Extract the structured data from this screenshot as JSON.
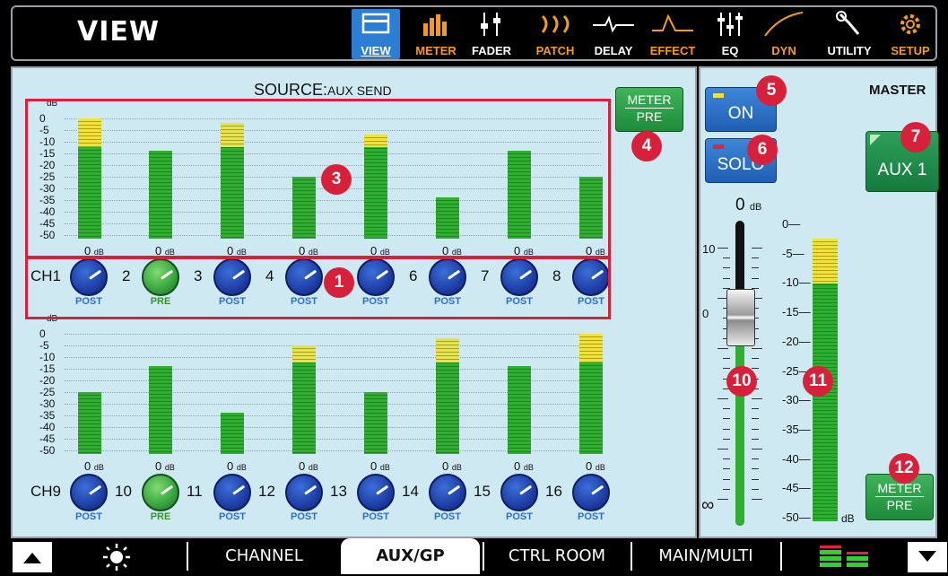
{
  "header": {
    "title": "VIEW",
    "menu": [
      {
        "label": "VIEW",
        "icon": "view-icon",
        "active": true
      },
      {
        "label": "METER",
        "icon": "meter-icon"
      },
      {
        "label": "FADER",
        "icon": "fader-icon"
      },
      {
        "label": "PATCH",
        "icon": "patch-icon"
      },
      {
        "label": "DELAY",
        "icon": "delay-icon"
      },
      {
        "label": "EFFECT",
        "icon": "effect-icon"
      },
      {
        "label": "EQ",
        "icon": "eq-icon"
      },
      {
        "label": "DYN",
        "icon": "dyn-icon"
      },
      {
        "label": "UTILITY",
        "icon": "utility-icon"
      },
      {
        "label": "SETUP",
        "icon": "setup-icon"
      }
    ]
  },
  "source": {
    "label": "SOURCE:",
    "value": "AUX SEND"
  },
  "scale": {
    "unit": "dB",
    "ticks": [
      "0",
      "-5",
      "-10",
      "-15",
      "-20",
      "-25",
      "-30",
      "-35",
      "-40",
      "-45",
      "-50"
    ]
  },
  "db_value": "0",
  "db_unit": "dB",
  "bank1": {
    "levels_db": [
      0,
      -14,
      -2,
      -25,
      -7,
      -34,
      -14,
      -25
    ],
    "channels": [
      {
        "label": "CH1",
        "mode": "POST"
      },
      {
        "label": "2",
        "mode": "PRE"
      },
      {
        "label": "3",
        "mode": "POST"
      },
      {
        "label": "4",
        "mode": "POST"
      },
      {
        "label": "5",
        "mode": "POST"
      },
      {
        "label": "6",
        "mode": "POST"
      },
      {
        "label": "7",
        "mode": "POST"
      },
      {
        "label": "8",
        "mode": "POST"
      }
    ]
  },
  "bank2": {
    "levels_db": [
      -25,
      -14,
      -34,
      -5,
      -25,
      -2,
      -14,
      0
    ],
    "channels": [
      {
        "label": "CH9",
        "mode": "POST"
      },
      {
        "label": "10",
        "mode": "PRE"
      },
      {
        "label": "11",
        "mode": "POST"
      },
      {
        "label": "12",
        "mode": "POST"
      },
      {
        "label": "13",
        "mode": "POST"
      },
      {
        "label": "14",
        "mode": "POST"
      },
      {
        "label": "15",
        "mode": "POST"
      },
      {
        "label": "16",
        "mode": "POST"
      }
    ]
  },
  "meter_pre_button": {
    "top": "METER",
    "bottom": "PRE"
  },
  "master": {
    "title": "MASTER",
    "on_label": "ON",
    "solo_label": "SOLO",
    "aux_label": "AUX 1",
    "fader_value": "0",
    "fader_unit": "dB",
    "fader_ticks": [
      "10",
      "0",
      "∞"
    ],
    "meter_ticks": [
      "0",
      "-5",
      "-10",
      "-15",
      "-20",
      "-25",
      "-30",
      "-35",
      "-40",
      "-45",
      "-50"
    ],
    "meter_unit": "dB",
    "meter_level_db": -3
  },
  "badges": [
    "1",
    "3",
    "4",
    "5",
    "6",
    "7",
    "10",
    "11",
    "12"
  ],
  "tabs": [
    {
      "label": "CHANNEL"
    },
    {
      "label": "AUX/GP",
      "active": true
    },
    {
      "label": "CTRL ROOM"
    },
    {
      "label": "MAIN/MULTI"
    }
  ],
  "colors": {
    "accent_red": "#d8203a",
    "meter_green": "#2fae2f",
    "meter_yellow": "#f0e040",
    "menu_orange": "#f39b1f",
    "panel_bg": "#cfe9f2"
  }
}
